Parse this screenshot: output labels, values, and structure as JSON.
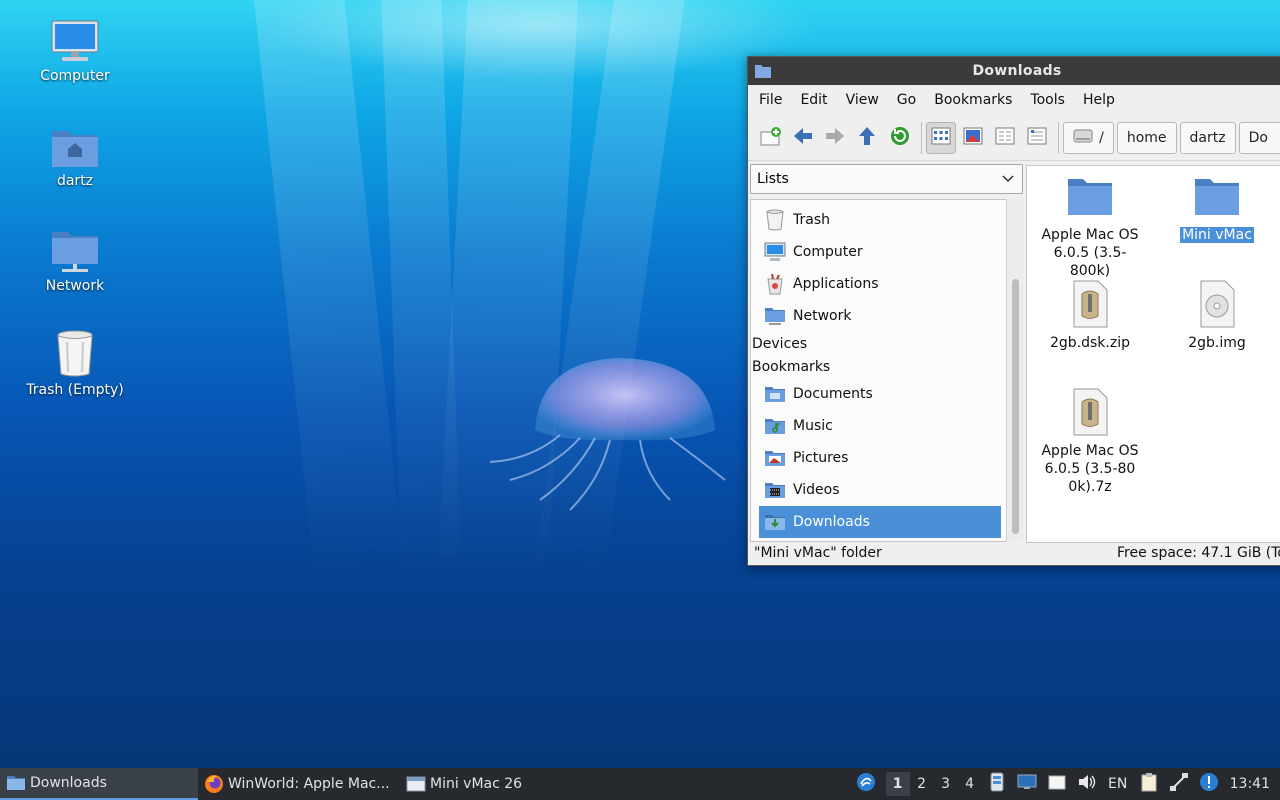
{
  "desktop": {
    "icons": [
      {
        "label": "Computer",
        "icon": "computer-icon"
      },
      {
        "label": "dartz",
        "icon": "home-folder-icon"
      },
      {
        "label": "Network",
        "icon": "network-folder-icon"
      },
      {
        "label": "Trash (Empty)",
        "icon": "trash-icon"
      }
    ]
  },
  "window": {
    "title": "Downloads",
    "menu": [
      "File",
      "Edit",
      "View",
      "Go",
      "Bookmarks",
      "Tools",
      "Help"
    ],
    "toolbar": {
      "buttons": [
        "new-folder-icon",
        "back-arrow-icon",
        "forward-arrow-icon",
        "up-arrow-icon",
        "reload-icon",
        "icon-view-icon",
        "thumbnail-view-icon",
        "compact-view-icon",
        "detailed-list-view-icon"
      ],
      "path": [
        "/",
        "home",
        "dartz",
        "Do"
      ]
    },
    "side": {
      "mode": "Lists",
      "places": [
        {
          "label": "Trash",
          "icon": "trash-icon"
        },
        {
          "label": "Computer",
          "icon": "computer-icon"
        },
        {
          "label": "Applications",
          "icon": "applications-icon"
        },
        {
          "label": "Network",
          "icon": "network-folder-icon"
        }
      ],
      "devices_header": "Devices",
      "bookmarks_header": "Bookmarks",
      "bookmarks": [
        {
          "label": "Documents",
          "icon": "documents-folder-icon"
        },
        {
          "label": "Music",
          "icon": "music-folder-icon"
        },
        {
          "label": "Pictures",
          "icon": "pictures-folder-icon"
        },
        {
          "label": "Videos",
          "icon": "videos-folder-icon"
        },
        {
          "label": "Downloads",
          "icon": "downloads-folder-icon",
          "selected": true
        }
      ]
    },
    "files": [
      {
        "name": "Apple Mac OS 6.0.5 (3.5-800k)",
        "type": "folder"
      },
      {
        "name": "Mini vMac",
        "type": "folder",
        "selected": true
      },
      {
        "name": "2gb.dsk.zip",
        "type": "archive"
      },
      {
        "name": "2gb.img",
        "type": "disk-image"
      },
      {
        "name": "Apple Mac OS 6.0.5 (3.5-800k).7z",
        "type": "archive"
      }
    ],
    "status": {
      "left": "\"Mini vMac\" folder",
      "right": "Free space: 47.1 GiB (To"
    }
  },
  "taskbar": {
    "tasks": [
      {
        "label": "Downloads",
        "icon": "folder-icon",
        "active": true
      },
      {
        "label": "WinWorld: Apple Mac...",
        "icon": "firefox-icon"
      },
      {
        "label": "Mini vMac 26",
        "icon": "window-icon"
      }
    ],
    "workspaces": [
      "1",
      "2",
      "3",
      "4"
    ],
    "current_workspace": "1",
    "language": "EN",
    "clock": "13:41"
  },
  "colors": {
    "selection": "#4a90d9",
    "titlebar": "#3b3b3b",
    "taskbar": "#262a2e",
    "folder": "#5b8fd4"
  }
}
